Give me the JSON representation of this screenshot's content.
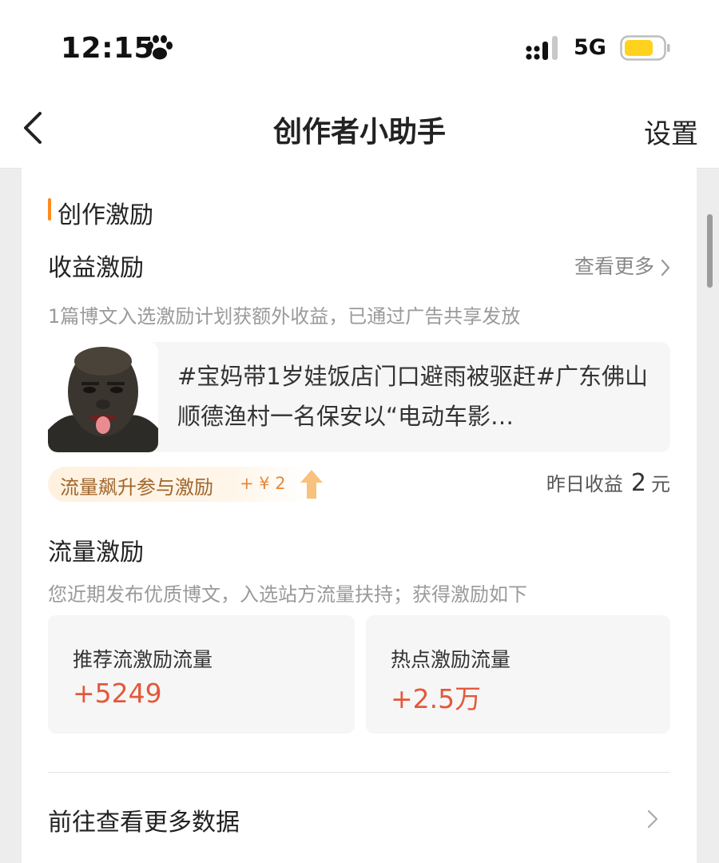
{
  "status_bar": {
    "time": "12:15",
    "network": "5G",
    "icons": [
      "paw-icon",
      "signal-icon",
      "battery-icon"
    ],
    "battery_color": "#ffd21e"
  },
  "nav": {
    "title": "创作者小助手",
    "settings_label": "设置",
    "back_icon": "chevron-left-icon"
  },
  "section": {
    "title": "创作激励",
    "accent_color": "#ff8a1f"
  },
  "revenue": {
    "title": "收益激励",
    "view_more": "查看更多",
    "description": "1篇博文入选激励计划获额外收益，已通过广告共享发放",
    "post": {
      "text": "#宝妈带1岁娃饭店门口避雨被驱赶#广东佛山顺德渔村一名保安以“电动车影…"
    },
    "boost": {
      "label": "流量飙升参与激励",
      "amount": "+ ¥ 2"
    },
    "yesterday": {
      "label": "昨日收益",
      "value": "2",
      "unit": "元"
    }
  },
  "traffic": {
    "title": "流量激励",
    "description": "您近期发布优质博文，入选站方流量扶持；获得激励如下",
    "stats": [
      {
        "label": "推荐流激励流量",
        "value": "+5249"
      },
      {
        "label": "热点激励流量",
        "value": "+2.5万"
      }
    ],
    "value_color": "#e4583a"
  },
  "footer": {
    "more_data_label": "前往查看更多数据"
  }
}
